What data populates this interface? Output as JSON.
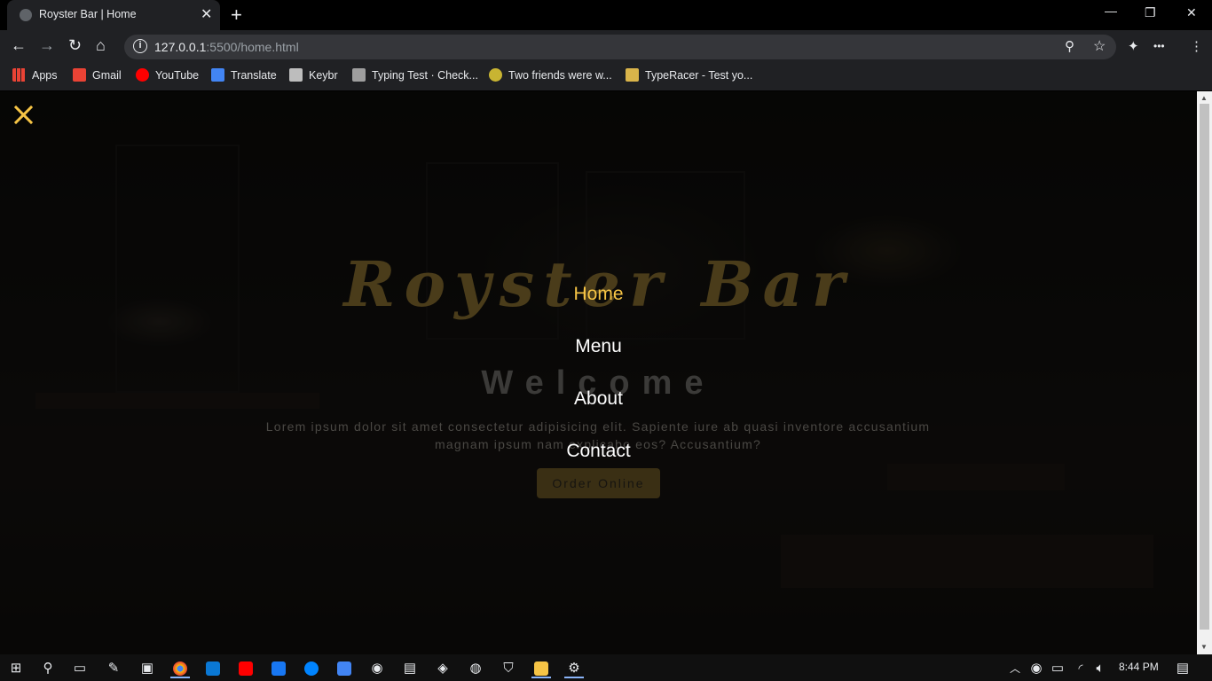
{
  "browser": {
    "tab_title": "Royster Bar | Home",
    "new_tab_symbol": "+",
    "tab_close_symbol": "✕",
    "url_host": "127.0.0.1",
    "url_rest": ":5500/home.html",
    "bookmarks": [
      "Apps",
      "Gmail",
      "YouTube",
      "Translate",
      "Keybr",
      "Typing Test · Check...",
      "Two friends were w...",
      "TypeRacer - Test yo..."
    ]
  },
  "page": {
    "brand": "Royster Bar",
    "welcome": "Welcome",
    "lorem_line1": "Lorem ipsum dolor sit amet consectetur adipisicing elit. Sapiente iure ab quasi inventore accusantium",
    "lorem_line2": "magnam ipsum nam explicabo eos? Accusantium?",
    "order_button": "Order Online",
    "nav": {
      "home": "Home",
      "menu": "Menu",
      "about": "About",
      "contact": "Contact"
    },
    "accent_color": "#f6c445"
  },
  "taskbar": {
    "time": "8:44 PM"
  }
}
